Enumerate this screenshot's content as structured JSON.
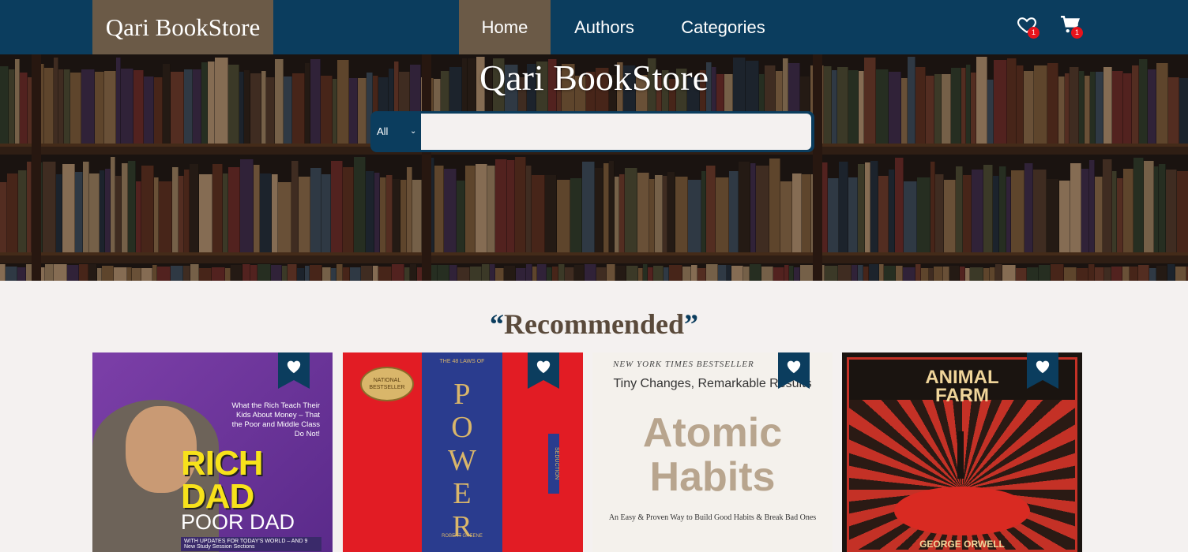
{
  "navbar": {
    "brand": "Qari BookStore",
    "links": [
      "Home",
      "Authors",
      "Categories"
    ],
    "wishlist_count": "1",
    "cart_count": "1"
  },
  "hero": {
    "title": "Qari BookStore",
    "search": {
      "category": "All",
      "value": "",
      "placeholder": ""
    }
  },
  "recommended": {
    "title": "Recommended",
    "books": [
      {
        "title_line1": "RICH",
        "title_line2": "DAD",
        "subtitle": "POOR DAD",
        "blurb": "What the Rich Teach Their Kids About Money – That the Poor and Middle Class Do Not!",
        "strip": "WITH UPDATES FOR TODAY'S WORLD – AND 9 New Study Session Sections"
      },
      {
        "top_text": "THE 48 LAWS OF",
        "title": "POWER",
        "seal": "NATIONAL BESTSELLER",
        "side_text": "SEDUCTION",
        "author": "ROBERT GREENE"
      },
      {
        "top_text": "NEW YORK TIMES BESTSELLER",
        "tagline": "Tiny Changes, Remarkable Results",
        "title_line1": "Atomic",
        "title_line2": "Habits",
        "subtitle": "An Easy & Proven Way to Build Good Habits & Break Bad Ones"
      },
      {
        "title_line1": "ANIMAL",
        "title_line2": "FARM",
        "author": "GEORGE ORWELL"
      }
    ]
  },
  "colors": {
    "navbar": "#0b3d5e",
    "brand_bg": "#6b5a47",
    "badge": "#e8131b",
    "page_bg": "#f4f1f0"
  }
}
